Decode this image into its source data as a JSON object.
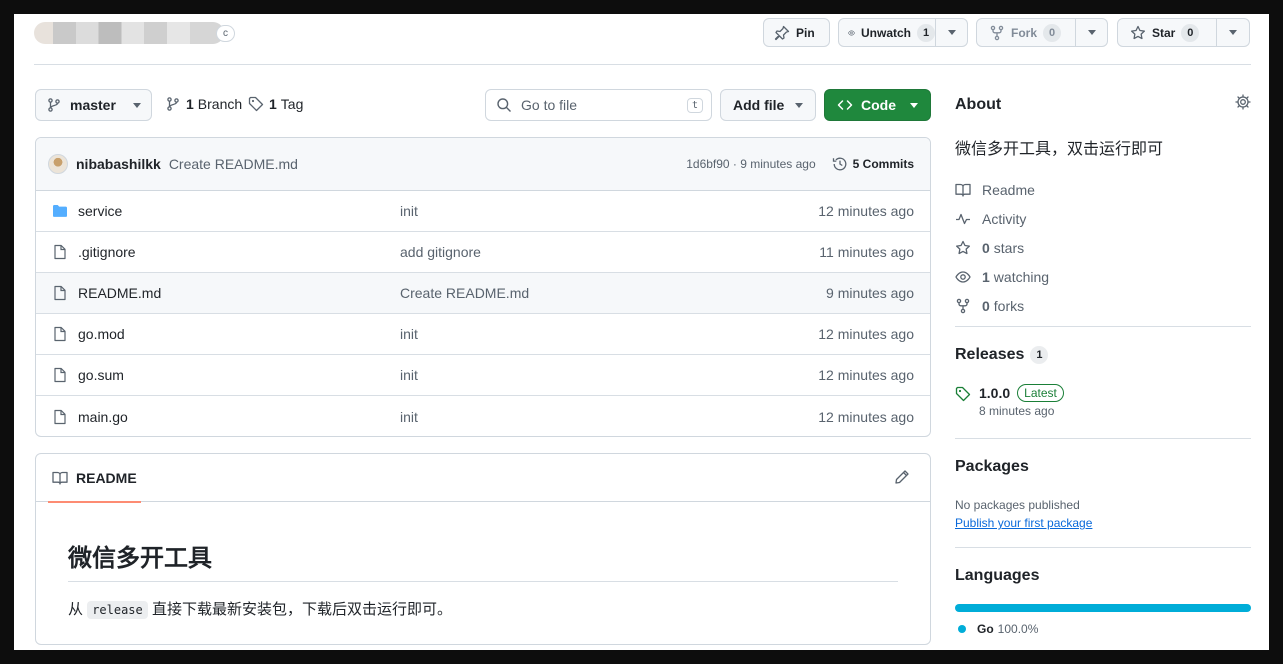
{
  "header": {
    "visibility_badge": "c",
    "pin_label": "Pin",
    "unwatch_label": "Unwatch",
    "unwatch_count": "1",
    "fork_label": "Fork",
    "fork_count": "0",
    "star_label": "Star",
    "star_count": "0"
  },
  "branchbar": {
    "branch_name": "master",
    "branches_count": "1",
    "branches_label": "Branch",
    "tags_count": "1",
    "tags_label": "Tag",
    "goto_placeholder": "Go to file",
    "goto_shortcut": "t",
    "add_file_label": "Add file",
    "code_label": "Code"
  },
  "latest_commit": {
    "author": "nibabashilkk",
    "message": "Create README.md",
    "hash_time": "1d6bf90 · 9 minutes ago",
    "commits_label": "5 Commits"
  },
  "files": [
    {
      "name": "service",
      "type": "folder",
      "message": "init",
      "time": "12 minutes ago"
    },
    {
      "name": ".gitignore",
      "type": "file",
      "message": "add gitignore",
      "time": "11 minutes ago"
    },
    {
      "name": "README.md",
      "type": "file",
      "message": "Create README.md",
      "time": "9 minutes ago"
    },
    {
      "name": "go.mod",
      "type": "file",
      "message": "init",
      "time": "12 minutes ago"
    },
    {
      "name": "go.sum",
      "type": "file",
      "message": "init",
      "time": "12 minutes ago"
    },
    {
      "name": "main.go",
      "type": "file",
      "message": "init",
      "time": "12 minutes ago"
    }
  ],
  "readme": {
    "tab_label": "README",
    "heading": "微信多开工具",
    "para_prefix": "从",
    "para_code": "release",
    "para_suffix": "直接下载最新安装包，下载后双击运行即可。"
  },
  "about": {
    "title": "About",
    "description": "微信多开工具，双击运行即可",
    "readme_label": "Readme",
    "activity_label": "Activity",
    "stars_count": "0",
    "stars_label": "stars",
    "watching_count": "1",
    "watching_label": "watching",
    "forks_count": "0",
    "forks_label": "forks"
  },
  "releases": {
    "title": "Releases",
    "count": "1",
    "version": "1.0.0",
    "latest_badge": "Latest",
    "time": "8 minutes ago"
  },
  "packages": {
    "title": "Packages",
    "none_text": "No packages published",
    "publish_link": "Publish your first package"
  },
  "languages": {
    "title": "Languages",
    "name": "Go",
    "percent": "100.0%",
    "color": "#00add8"
  },
  "colors": {
    "code_button": "#1f883d",
    "link": "#0969da",
    "tab_underline": "#fd8c73",
    "folder_icon": "#54aeff"
  }
}
